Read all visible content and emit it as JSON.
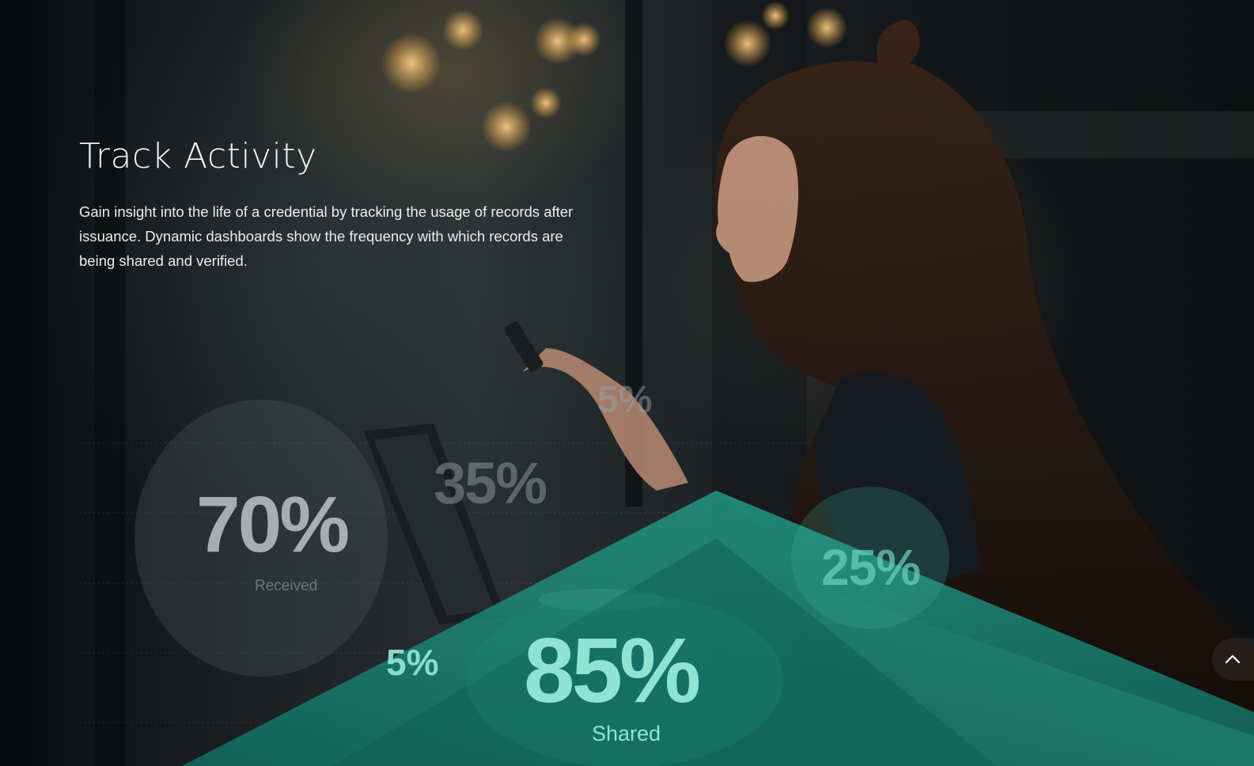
{
  "feature": {
    "title": "Track Activity",
    "description": "Gain insight into the life of a credential by tracking the usage of records after issuance. Dynamic dashboards show the frequency with which records are being shared and verified."
  },
  "stats": {
    "received": {
      "value": "70%",
      "label": "Received"
    },
    "top_faded": {
      "value": "35%"
    },
    "partial": {
      "value": "5%"
    },
    "right": {
      "value": "25%"
    },
    "small": {
      "value": "5%"
    },
    "shared": {
      "value": "85%",
      "label": "Shared"
    }
  },
  "colors": {
    "accent": "#2bb39a",
    "accent_dark": "#0f6e63",
    "stat_teal": "#8fe3d3",
    "stat_grey": "#b9bdbf"
  },
  "icons": {
    "scroll_top": "chevron-up-icon"
  }
}
